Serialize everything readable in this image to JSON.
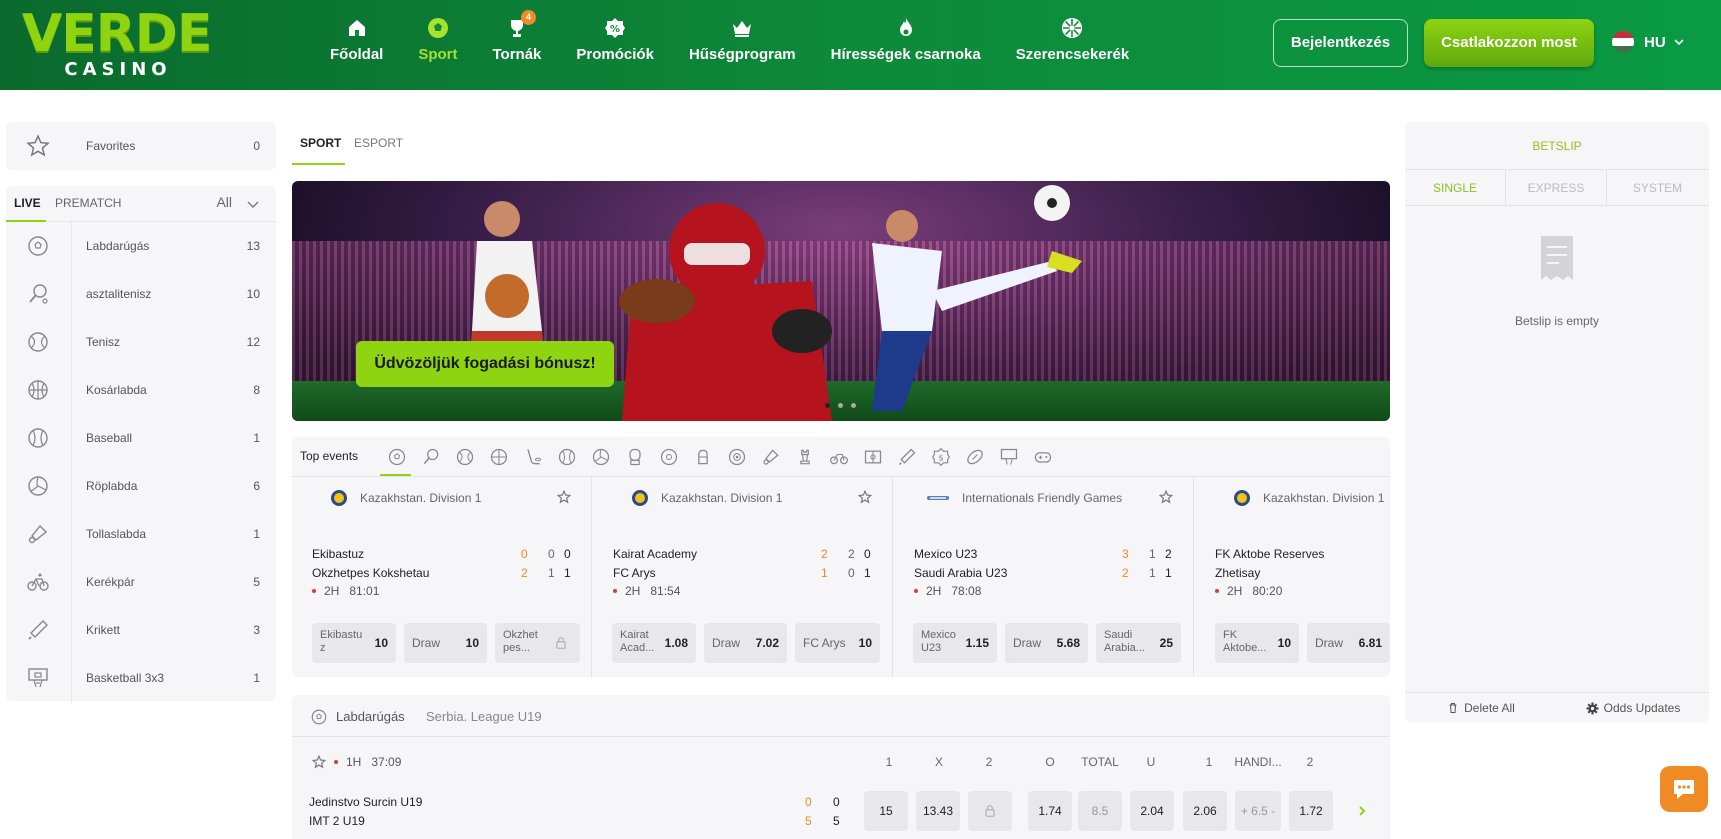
{
  "brand": {
    "name_top": "VERDE",
    "name_bottom": "CASINO"
  },
  "nav": {
    "items": [
      {
        "label": "Főoldal",
        "icon": "home-icon"
      },
      {
        "label": "Sport",
        "icon": "soccer-ball-icon",
        "active": true
      },
      {
        "label": "Tornák",
        "icon": "trophy-icon",
        "badge": "4"
      },
      {
        "label": "Promóciók",
        "icon": "percent-badge-icon"
      },
      {
        "label": "Hűségprogram",
        "icon": "crown-icon"
      },
      {
        "label": "Hírességek csarnoka",
        "icon": "flame-icon"
      },
      {
        "label": "Szerencsekerék",
        "icon": "wheel-icon"
      }
    ]
  },
  "header": {
    "login_label": "Bejelentkezés",
    "join_label": "Csatlakozzon most",
    "language": "HU"
  },
  "sidebar": {
    "favorites_label": "Favorites",
    "favorites_count": "0",
    "tabs": {
      "live": "LIVE",
      "prematch": "PREMATCH",
      "filter": "All"
    },
    "sports": [
      {
        "label": "Labdarúgás",
        "count": "13",
        "icon": "soccer-icon"
      },
      {
        "label": "asztalitenisz",
        "count": "10",
        "icon": "table-tennis-icon"
      },
      {
        "label": "Tenisz",
        "count": "12",
        "icon": "tennis-icon"
      },
      {
        "label": "Kosárlabda",
        "count": "8",
        "icon": "basketball-icon"
      },
      {
        "label": "Baseball",
        "count": "1",
        "icon": "baseball-icon"
      },
      {
        "label": "Röplabda",
        "count": "6",
        "icon": "volleyball-icon"
      },
      {
        "label": "Tollaslabda",
        "count": "1",
        "icon": "shuttlecock-icon"
      },
      {
        "label": "Kerékpár",
        "count": "5",
        "icon": "bicycle-icon"
      },
      {
        "label": "Krikett",
        "count": "3",
        "icon": "cricket-icon"
      },
      {
        "label": "Basketball 3x3",
        "count": "1",
        "icon": "hoop-icon"
      }
    ]
  },
  "main": {
    "tabs": {
      "sport": "SPORT",
      "esport": "ESPORT"
    },
    "banner": {
      "cta": "Üdvözöljük fogadási bónusz!"
    },
    "top_events": {
      "label": "Top events",
      "filter_icons": [
        "soccer-icon",
        "table-tennis-icon",
        "tennis-icon",
        "basketball-icon",
        "hockey-icon",
        "baseball-icon",
        "volleyball-icon",
        "boxing-icon",
        "futsal-icon",
        "mma-glove-icon",
        "handball-icon",
        "shuttlecock-icon",
        "chess-icon",
        "bicycle-icon",
        "field-hockey-icon",
        "cricket-icon",
        "dollar-icon",
        "rugby-icon",
        "hoop-icon",
        "gamepad-icon"
      ],
      "matches": [
        {
          "league": "Kazakhstan. Division 1",
          "team1": "Ekibastuz",
          "team2": "Okzhetpes Kokshetau",
          "s1a": "0",
          "s2a": "0",
          "s3a": "0",
          "s1b": "2",
          "s2b": "1",
          "s3b": "1",
          "period": "2H",
          "time": "81:01",
          "odd1_name": "Ekibastu z",
          "odd1": "10",
          "oddx_name": "Draw",
          "oddx": "10",
          "odd2_name": "Okzhet pes...",
          "odd2": ""
        },
        {
          "league": "Kazakhstan. Division 1",
          "team1": "Kairat Academy",
          "team2": "FC Arys",
          "s1a": "2",
          "s2a": "2",
          "s3a": "0",
          "s1b": "1",
          "s2b": "0",
          "s3b": "1",
          "period": "2H",
          "time": "81:54",
          "odd1_name": "Kairat Acad...",
          "odd1": "1.08",
          "oddx_name": "Draw",
          "oddx": "7.02",
          "odd2_name": "FC Arys",
          "odd2": "10"
        },
        {
          "league": "Internationals Friendly Games",
          "team1": "Mexico U23",
          "team2": "Saudi Arabia U23",
          "s1a": "3",
          "s2a": "1",
          "s3a": "2",
          "s1b": "2",
          "s2b": "1",
          "s3b": "1",
          "period": "2H",
          "time": "78:08",
          "odd1_name": "Mexico U23",
          "odd1": "1.15",
          "oddx_name": "Draw",
          "oddx": "5.68",
          "odd2_name": "Saudi Arabia...",
          "odd2": "25"
        },
        {
          "league": "Kazakhstan. Division 1",
          "team1": "FK Aktobe Reserves",
          "team2": "Zhetisay",
          "period": "2H",
          "time": "80:20",
          "odd1_name": "FK Aktobe...",
          "odd1": "10",
          "oddx_name": "Draw",
          "oddx": "6.81"
        }
      ]
    },
    "live_section": {
      "sport": "Labdarúgás",
      "league": "Serbia. League U19",
      "columns": [
        "1",
        "X",
        "2",
        "O",
        "TOTAL",
        "U",
        "1",
        "HANDI...",
        "2"
      ],
      "period": "1H",
      "time": "37:09",
      "team1": "Jedinstvo Surcin U19",
      "team2": "IMT 2 U19",
      "score_a1": "0",
      "score_b1": "0",
      "score_a2": "5",
      "score_b2": "5",
      "odds": [
        "15",
        "13.43",
        "",
        "1.74",
        "8.5",
        "2.04",
        "2.06",
        "+ 6.5 -",
        "1.72"
      ]
    }
  },
  "betslip": {
    "title": "BETSLIP",
    "tabs": [
      "SINGLE",
      "EXPRESS",
      "SYSTEM"
    ],
    "empty": "Betslip is empty",
    "delete_all": "Delete All",
    "odds_updates": "Odds Updates"
  },
  "colors": {
    "accent": "#8fd411",
    "header": "#0d8a3a",
    "orange": "#f08a24",
    "live": "#e53935"
  }
}
